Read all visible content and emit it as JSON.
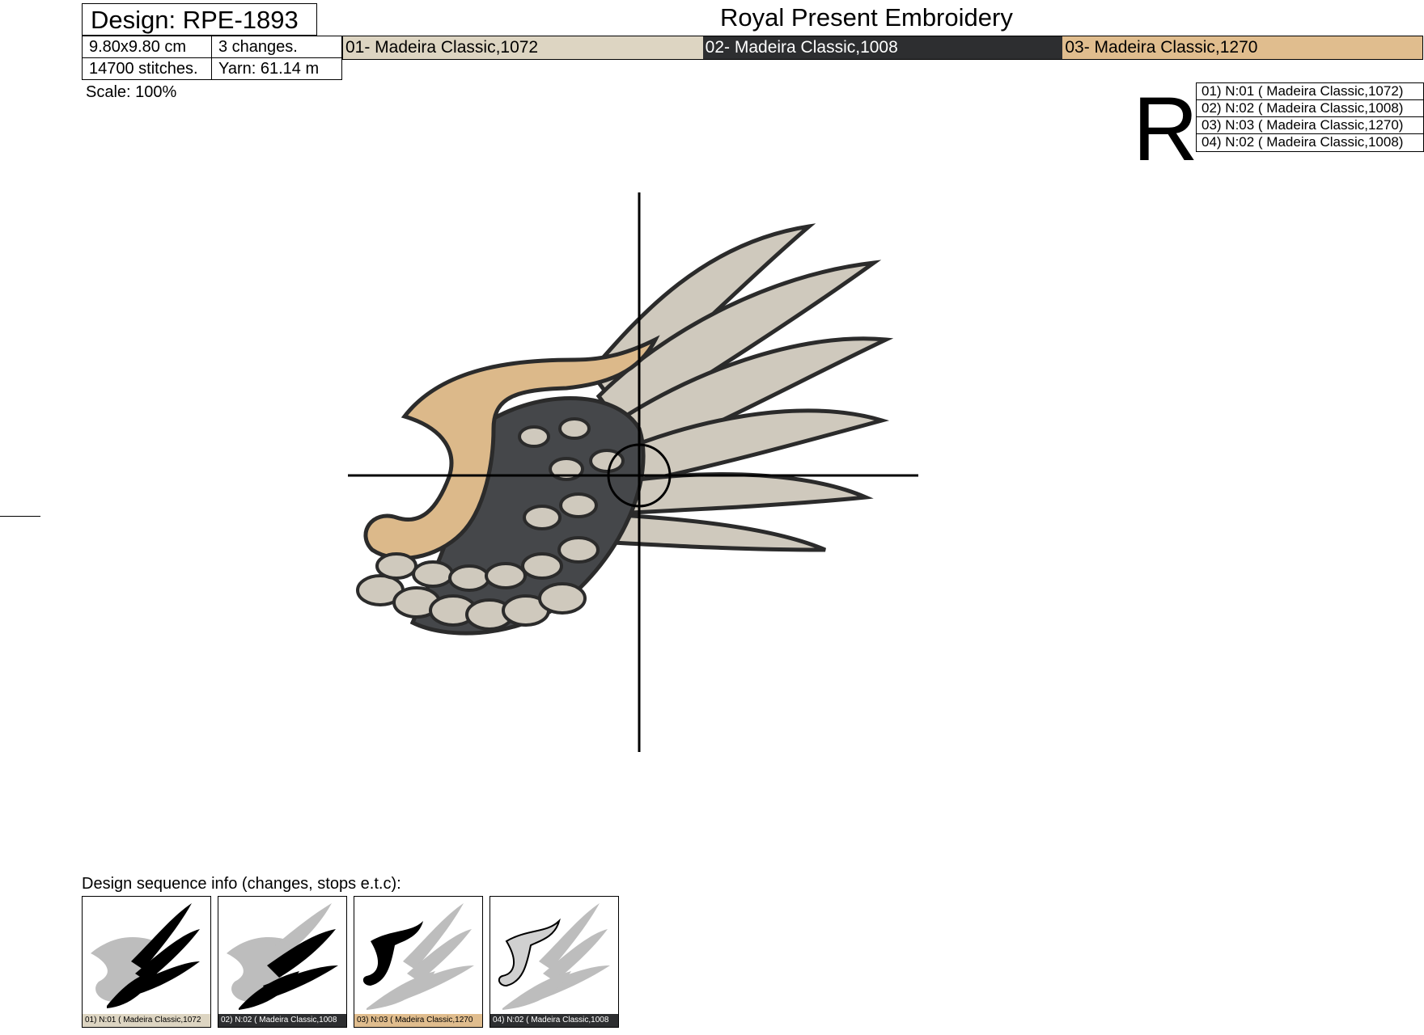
{
  "header": {
    "design_label": "Design: RPE-1893",
    "brand": "Royal Present Embroidery",
    "size": "9.80x9.80 cm",
    "changes": "3 changes.",
    "stitches": "14700 stitches.",
    "yarn": "Yarn: 61.14 m",
    "scale": "Scale: 100%"
  },
  "color_bar": [
    {
      "label": "01- Madeira Classic,1072",
      "bg": "#ddd5c2",
      "fg": "#000000"
    },
    {
      "label": "02- Madeira Classic,1008",
      "bg": "#2d2e30",
      "fg": "#ffffff"
    },
    {
      "label": "03- Madeira Classic,1270",
      "bg": "#e0bd8e",
      "fg": "#000000"
    }
  ],
  "corner_mark": "R",
  "legend": [
    "01) N:01 ( Madeira Classic,1072)",
    "02) N:02 ( Madeira Classic,1008)",
    "03) N:03 ( Madeira Classic,1270)",
    "04) N:02 ( Madeira Classic,1008)"
  ],
  "sequence": {
    "title": "Design sequence info (changes, stops e.t.c):",
    "steps": [
      {
        "caption": "01) N:01 ( Madeira Classic,1072",
        "cap_bg": "#ddd5c2",
        "cap_fg": "#000000"
      },
      {
        "caption": "02) N:02 ( Madeira Classic,1008",
        "cap_bg": "#2d2e30",
        "cap_fg": "#ffffff"
      },
      {
        "caption": "03) N:03 ( Madeira Classic,1270",
        "cap_bg": "#e0bd8e",
        "cap_fg": "#000000"
      },
      {
        "caption": "04) N:02 ( Madeira Classic,1008",
        "cap_bg": "#2d2e30",
        "cap_fg": "#ffffff"
      }
    ]
  },
  "colors": {
    "feather_light": "#cfc9bd",
    "feather_dark": "#45474a",
    "feather_tan": "#dcb98a",
    "outline": "#2b2b2b"
  }
}
